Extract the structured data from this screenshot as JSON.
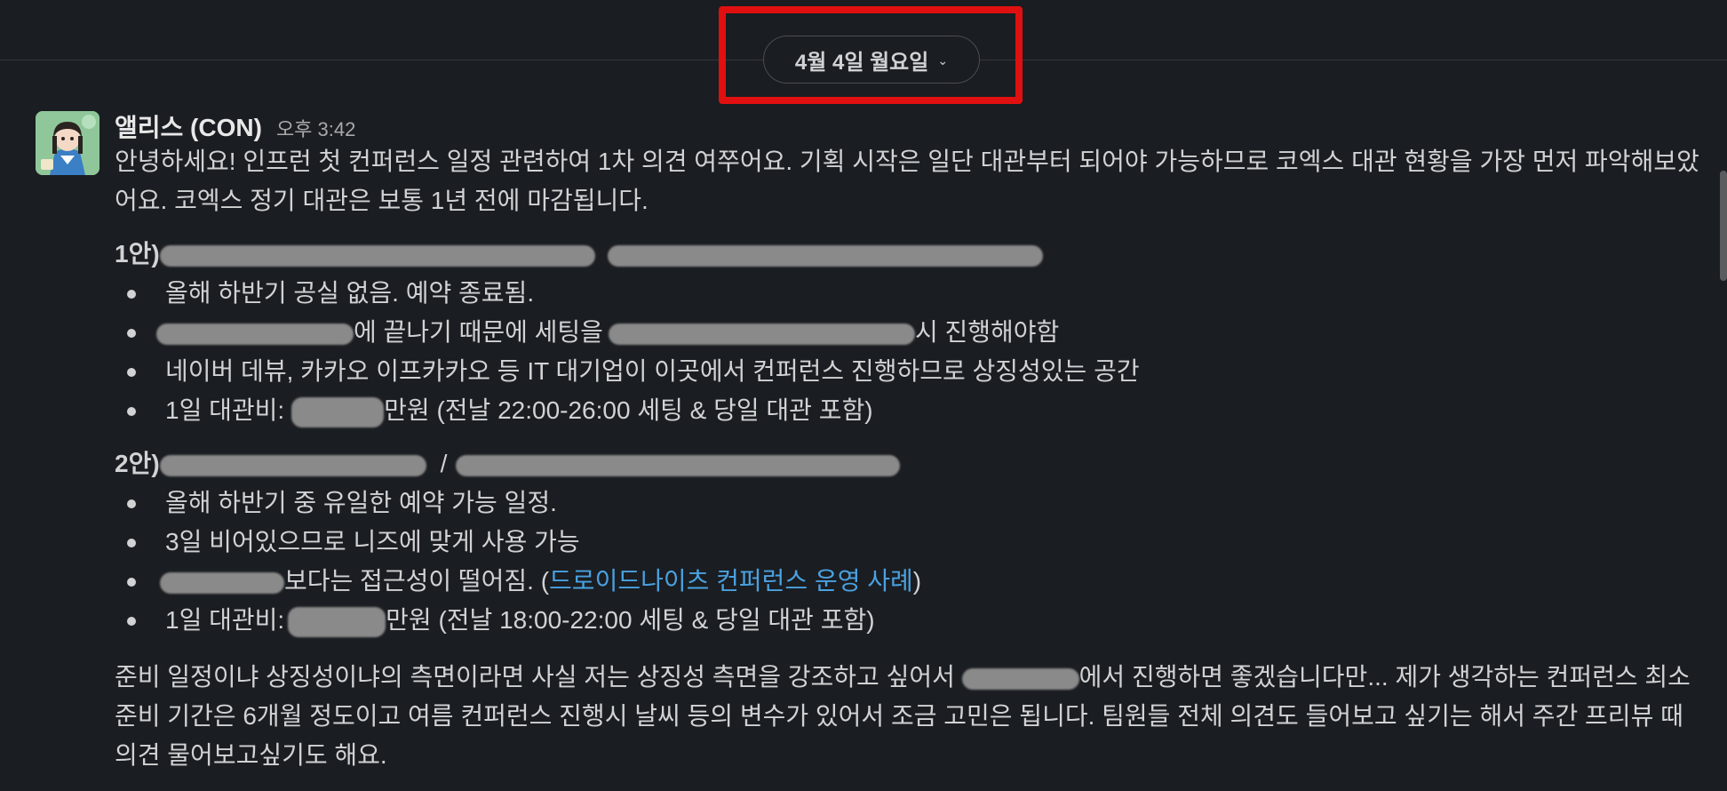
{
  "date_divider": {
    "label": "4월 4일 월요일",
    "chevron_icon": "chevron-down-icon"
  },
  "message": {
    "sender": "앨리스 (CON)",
    "time": "오후 3:42",
    "avatar_icon": "anime-girl-avatar",
    "intro": "안녕하세요! 인프런 첫 컨퍼런스 일정 관련하여 1차 의견 여쭈어요. 기획 시작은 일단 대관부터 되어야 가능하므로 코엑스 대관 현황을 가장 먼저 파악해보았어요. 코엑스 정기 대관은 보통 1년 전에 마감됩니다.",
    "option1": {
      "label": "1안)",
      "bullets": [
        "올해 하반기 공실 없음. 예약 종료됨.",
        "에 끝나기 때문에 세팅을",
        "시 진행해야함",
        "네이버 데뷰, 카카오 이프카카오 등 IT 대기업이 이곳에서 컨퍼런스 진행하므로 상징성있는 공간",
        "1일 대관비:",
        "만원 (전날 22:00-26:00 세팅 & 당일 대관 포함)"
      ]
    },
    "option2": {
      "label": "2안)",
      "separator": "/",
      "bullets": [
        "올해 하반기 중 유일한 예약 가능 일정.",
        "3일 비어있으므로 니즈에 맞게 사용 가능",
        "보다는 접근성이 떨어짐. (",
        "드로이드나이츠 컨퍼런스 운영 사례",
        ")",
        "1일 대관비:",
        "만원 (전날 18:00-22:00 세팅 & 당일 대관 포함)"
      ]
    },
    "closing_a": "준비 일정이냐 상징성이냐의 측면이라면 사실 저는 상징성 측면을 강조하고 싶어서",
    "closing_b": "에서 진행하면 좋겠습니다만... 제가 생각하는 컨퍼런스 최소 준비 기간은 6개월 정도이고 여름 컨퍼런스 진행시 날씨 등의 변수가 있어서 조금 고민은 됩니다. 팀원들 전체 의견도 들어보고 싶기는 해서 주간 프리뷰 때 의견 물어보고싶기도 해요."
  },
  "colors": {
    "background": "#1a1d21",
    "text": "#d1d2d3",
    "link": "#4aa1e0",
    "highlight": "#e01010",
    "redacted": "#8a8a8a"
  }
}
